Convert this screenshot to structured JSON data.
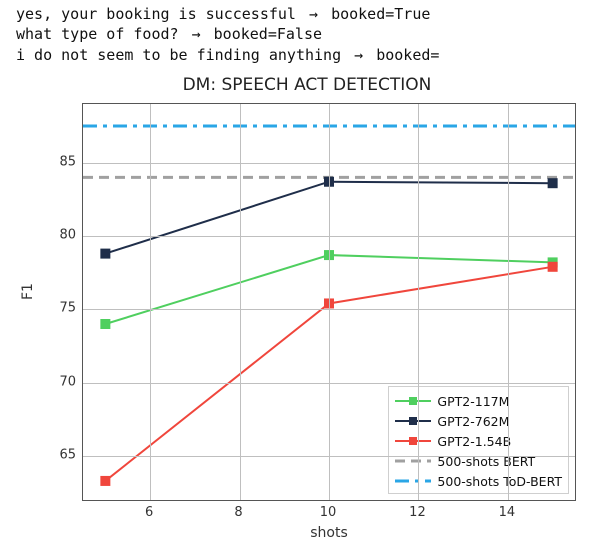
{
  "code_lines": [
    {
      "text": "yes, your booking is successful",
      "label": "booked=True"
    },
    {
      "text": "what type of food? ",
      "label": "booked=False"
    },
    {
      "text": "i do not seem to be finding anything",
      "label": "booked="
    }
  ],
  "chart_data": {
    "type": "line",
    "title": "DM: SPEECH ACT DETECTION",
    "xlabel": "shots",
    "ylabel": "F1",
    "x": [
      5,
      10,
      15
    ],
    "x_ticks": [
      6,
      8,
      10,
      12,
      14
    ],
    "y_ticks": [
      65,
      70,
      75,
      80,
      85
    ],
    "ylim": [
      62,
      89
    ],
    "series": [
      {
        "name": "GPT2-117M",
        "color": "#4fcf5f",
        "marker": "square",
        "values": [
          74.0,
          78.7,
          78.2
        ]
      },
      {
        "name": "GPT2-762M",
        "color": "#1f2e4a",
        "marker": "square",
        "values": [
          78.8,
          83.7,
          83.6
        ]
      },
      {
        "name": "GPT2-1.54B",
        "color": "#f0463c",
        "marker": "square",
        "values": [
          63.3,
          75.4,
          77.9
        ]
      }
    ],
    "hlines": [
      {
        "name": "500-shots BERT",
        "color": "#a0a0a0",
        "dash": "10,6",
        "y": 84.0
      },
      {
        "name": "500-shots ToD-BERT",
        "color": "#2aa6e6",
        "dash": "14,6,4,6",
        "y": 87.5
      }
    ],
    "legend": [
      {
        "label": "GPT2-117M",
        "kind": "series",
        "idx": 0
      },
      {
        "label": "GPT2-762M",
        "kind": "series",
        "idx": 1
      },
      {
        "label": "GPT2-1.54B",
        "kind": "series",
        "idx": 2
      },
      {
        "label": "500-shots BERT",
        "kind": "hline",
        "idx": 0
      },
      {
        "label": "500-shots ToD-BERT",
        "kind": "hline",
        "idx": 1
      }
    ]
  }
}
